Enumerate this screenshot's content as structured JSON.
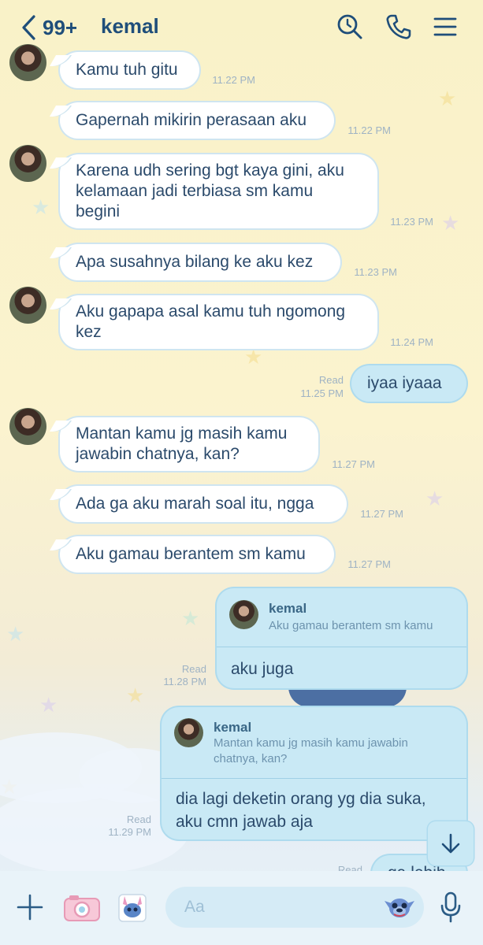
{
  "header": {
    "unread_count": "99+",
    "chat_name": "kemal",
    "icons": [
      "back-chevron-icon",
      "search-icon",
      "phone-icon",
      "menu-icon"
    ]
  },
  "messages": [
    {
      "dir": "in",
      "text": "Kamu tuh gitu",
      "time": "11.22 PM"
    },
    {
      "dir": "in",
      "text": "Gapernah mikirin perasaan aku",
      "time": "11.22 PM"
    },
    {
      "dir": "in",
      "text": "Karena udh sering bgt kaya gini, aku kelamaan jadi terbiasa sm kamu begini",
      "time": "11.23 PM"
    },
    {
      "dir": "in",
      "text": "Apa susahnya bilang ke aku kez",
      "time": "11.23 PM"
    },
    {
      "dir": "in",
      "text": "Aku gapapa asal kamu tuh ngomong kez",
      "time": "11.24 PM"
    },
    {
      "dir": "out",
      "text": "iyaa iyaaa",
      "read": "Read",
      "time": "11.25 PM"
    },
    {
      "dir": "in",
      "text": "Mantan kamu jg masih kamu jawabin chatnya, kan?",
      "time": "11.27 PM"
    },
    {
      "dir": "in",
      "text": "Ada ga aku marah soal itu, ngga",
      "time": "11.27 PM"
    },
    {
      "dir": "in",
      "text": "Aku gamau berantem sm kamu",
      "time": "11.27 PM"
    }
  ],
  "replies": [
    {
      "quoted_name": "kemal",
      "quoted_text": "Aku gamau berantem sm kamu",
      "text": "aku juga",
      "read": "Read",
      "time": "11.28 PM"
    },
    {
      "quoted_name": "kemal",
      "quoted_text": "Mantan kamu jg masih kamu jawabin chatnya, kan?",
      "text": "dia lagi deketin orang yg dia suka, aku cmn jawab aja",
      "read": "Read",
      "time": "11.29 PM"
    }
  ],
  "partial_message": {
    "text": "ga lebih",
    "read": "Read"
  },
  "input": {
    "placeholder": "Aa"
  },
  "bottom_icons": [
    "plus-icon",
    "camera-icon",
    "sticker-icon",
    "emoji-stitch-icon",
    "microphone-icon"
  ],
  "colors": {
    "accent": "#1f4e7a",
    "bubble_out": "#c9e9f5",
    "bubble_in": "#ffffff",
    "meta": "#9fb3c4"
  }
}
